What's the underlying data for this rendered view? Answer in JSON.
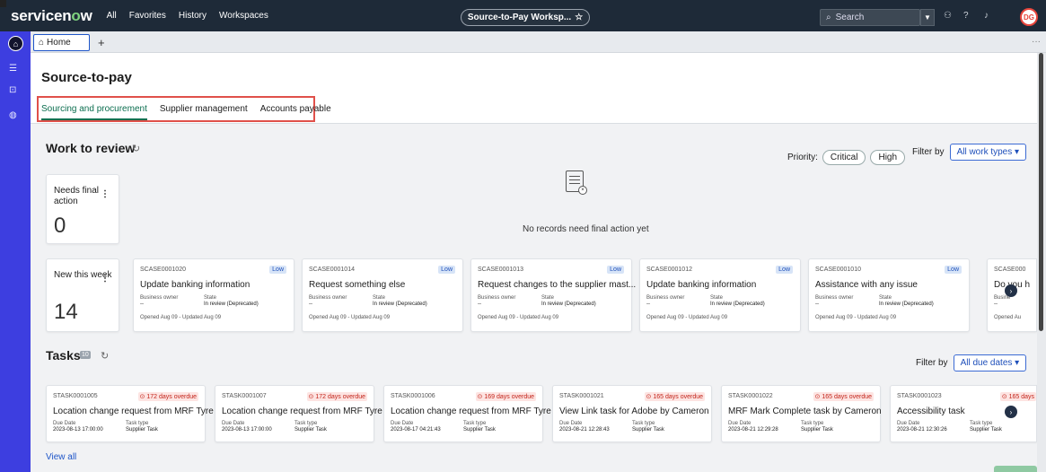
{
  "topbar": {
    "logo_prefix": "servicen",
    "logo_o": "o",
    "logo_suffix": "w",
    "nav": [
      "All",
      "Favorites",
      "History",
      "Workspaces"
    ],
    "workspace_pill": "Source-to-Pay Worksp...",
    "search_placeholder": "Search",
    "avatar_initials": "DG"
  },
  "tabbar": {
    "home_label": "Home",
    "add_label": "+"
  },
  "page": {
    "title": "Source-to-pay",
    "tabs": [
      "Sourcing and procurement",
      "Supplier management",
      "Accounts payable"
    ]
  },
  "work_to_review": {
    "title": "Work to review",
    "priority_label": "Priority:",
    "priority_options": [
      "Critical",
      "High"
    ],
    "filter_label": "Filter by",
    "filter_value": "All work types ▾",
    "needs_final_action": {
      "label": "Needs final action",
      "value": "0"
    },
    "empty_text": "No records need final action yet",
    "new_this_week": {
      "label": "New this week",
      "value": "14"
    },
    "cases": [
      {
        "number": "SCASE0001020",
        "badge": "Low",
        "title": "Update banking information",
        "owner_label": "Business owner",
        "owner": "--",
        "state_label": "State",
        "state": "In review (Deprecated)",
        "footer": "Opened Aug 09 - Updated Aug 09"
      },
      {
        "number": "SCASE0001014",
        "badge": "Low",
        "title": "Request something else",
        "owner_label": "Business owner",
        "owner": "--",
        "state_label": "State",
        "state": "In review (Deprecated)",
        "footer": "Opened Aug 09 - Updated Aug 09"
      },
      {
        "number": "SCASE0001013",
        "badge": "Low",
        "title": "Request changes to the supplier mast...",
        "owner_label": "Business owner",
        "owner": "--",
        "state_label": "State",
        "state": "In review (Deprecated)",
        "footer": "Opened Aug 09 - Updated Aug 09"
      },
      {
        "number": "SCASE0001012",
        "badge": "Low",
        "title": "Update banking information",
        "owner_label": "Business owner",
        "owner": "--",
        "state_label": "State",
        "state": "In review (Deprecated)",
        "footer": "Opened Aug 09 - Updated Aug 09"
      },
      {
        "number": "SCASE0001010",
        "badge": "Low",
        "title": "Assistance with any issue",
        "owner_label": "Business owner",
        "owner": "--",
        "state_label": "State",
        "state": "In review (Deprecated)",
        "footer": "Opened Aug 09 - Updated Aug 09"
      }
    ],
    "partial_case": {
      "number": "SCASE000",
      "title": "Do you h",
      "owner_label": "Busine",
      "owner": "--",
      "footer": "Opened Au"
    }
  },
  "tasks": {
    "title": "Tasks",
    "count": "10",
    "filter_label": "Filter by",
    "filter_value": "All due dates ▾",
    "items": [
      {
        "number": "STASK0001005",
        "overdue": "⊙ 172 days overdue",
        "title": "Location change request from MRF Tyre",
        "due_label": "Due Date",
        "due": "2023-08-13 17:00:00",
        "type_label": "Task type",
        "type": "Supplier Task"
      },
      {
        "number": "STASK0001007",
        "overdue": "⊙ 172 days overdue",
        "title": "Location change request from MRF Tyre",
        "due_label": "Due Date",
        "due": "2023-08-13 17:00:00",
        "type_label": "Task type",
        "type": "Supplier Task"
      },
      {
        "number": "STASK0001006",
        "overdue": "⊙ 169 days overdue",
        "title": "Location change request from MRF Tyre",
        "due_label": "Due Date",
        "due": "2023-08-17 04:21:43",
        "type_label": "Task type",
        "type": "Supplier Task"
      },
      {
        "number": "STASK0001021",
        "overdue": "⊙ 165 days overdue",
        "title": "View Link task for Adobe by Cameron",
        "due_label": "Due Date",
        "due": "2023-08-21 12:28:43",
        "type_label": "Task type",
        "type": "Supplier Task"
      },
      {
        "number": "STASK0001022",
        "overdue": "⊙ 165 days overdue",
        "title": "MRF Mark Complete task by Cameron",
        "due_label": "Due Date",
        "due": "2023-08-21 12:29:28",
        "type_label": "Task type",
        "type": "Supplier Task"
      },
      {
        "number": "STASK0001023",
        "overdue": "⊙ 165 days",
        "title": "Accessibility task",
        "due_label": "Due Date",
        "due": "2023-08-21 12:30:26",
        "type_label": "Task type",
        "type": "Supplier Task"
      }
    ],
    "view_all": "View all"
  }
}
